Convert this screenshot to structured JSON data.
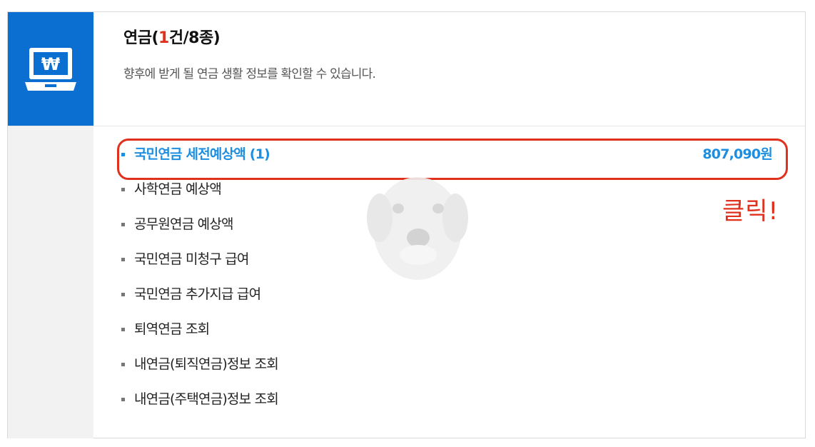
{
  "header": {
    "title_prefix": "연금(",
    "title_count": "1",
    "title_suffix": "건/8종)",
    "subtitle": "향후에 받게 될 연금 생활 정보를 확인할 수 있습니다.",
    "icon": "laptop-won-icon",
    "icon_symbol": "₩"
  },
  "items": [
    {
      "label": "국민연금 세전예상액 (1)",
      "amount": "807,090원",
      "active": true
    },
    {
      "label": "사학연금 예상액"
    },
    {
      "label": "공무원연금 예상액"
    },
    {
      "label": "국민연금 미청구 급여"
    },
    {
      "label": "국민연금 추가지급 급여"
    },
    {
      "label": "퇴역연금 조회"
    },
    {
      "label": "내연금(퇴직연금)정보 조회"
    },
    {
      "label": "내연금(주택연금)정보 조회"
    }
  ],
  "annotation": {
    "text": "클릭!"
  },
  "colors": {
    "brand_blue": "#0a6fd0",
    "active_blue": "#1e8fe0",
    "highlight_red": "#e0301e"
  }
}
